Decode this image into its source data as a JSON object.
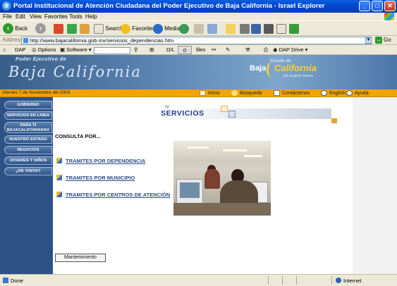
{
  "window": {
    "title": "Portal Institucional de Atención Ciudadana del Poder Ejecutivo de Baja California - Israel Explorer",
    "minimize": "_",
    "maximize": "□",
    "close": "✕"
  },
  "menu": [
    "File",
    "Edit",
    "View",
    "Favorites",
    "Tools",
    "Help"
  ],
  "toolbar": {
    "back": "Back",
    "search": "Search",
    "favorites": "Favorites",
    "media": "Media"
  },
  "address": {
    "label": "Address",
    "url": "http://www.bajacalifornia.gob.mx/servicios_dependencias.htm",
    "go": "Go"
  },
  "links_bar": {
    "dap": "DAP",
    "options": "Options",
    "software": "Software",
    "dl": "D/L",
    "count": "0",
    "files": "files",
    "dap_drive": "DAP Drive"
  },
  "header": {
    "poder": "Poder Ejecutivo de",
    "title": "Baja California",
    "logo_top": "Estado de",
    "logo_baja": "Baja",
    "logo_california": "California",
    "logo_tag": "por la gente buena"
  },
  "topbar": {
    "date": "Viernes 7 de Noviembre del 2003",
    "links": [
      "Inicio",
      "Búsqueda",
      "Contáctenos",
      "English",
      "Ayuda"
    ]
  },
  "nav": [
    "GOBIERNO",
    "SERVICIOS EN LINEA",
    "PARA TI BAJACALIFORNIANO",
    "NUESTRO ESTADO",
    "NEGOCIOS",
    "JOVENES Y NIÑOS",
    "¿DE VISITA?"
  ],
  "main": {
    "section_title": "SERVICIOS",
    "consulta": "CONSULTA POR...",
    "tramites": [
      "TRAMITES POR DEPENDENCIA",
      "TRAMITES POR MUNICIPIO",
      "TRAMITES POR CENTROS DE ATENCIÓN"
    ],
    "mantenimiento": "Mantenimiento"
  },
  "status": {
    "left": "Done",
    "zone": "Internet"
  }
}
